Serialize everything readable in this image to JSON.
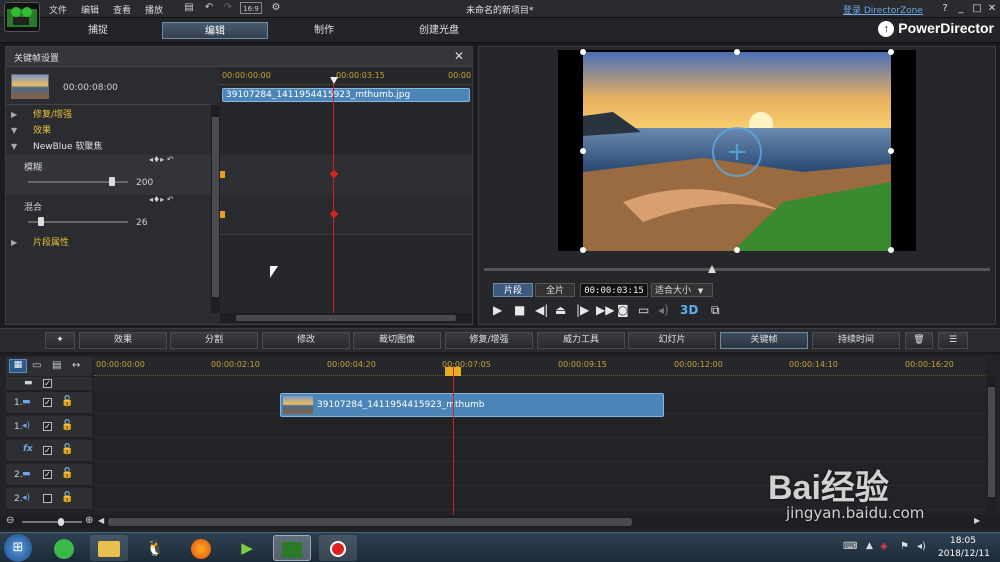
{
  "window": {
    "title": "未命名的新项目*",
    "zone_link": "登录 DirectorZone",
    "help": "?",
    "minimize": "_",
    "maximize": "□",
    "close": "✕",
    "aspect": "16:9"
  },
  "menu": [
    "文件",
    "编辑",
    "查看",
    "播放"
  ],
  "modes": {
    "capture": "捕捉",
    "edit": "编辑",
    "produce": "制作",
    "disc": "创建光盘",
    "logo": "PowerDirector"
  },
  "keyframe": {
    "title": "关键帧设置",
    "duration": "00:00:08:00",
    "ruler": [
      "00:00:00:00",
      "00:00:03:15",
      "00:00"
    ],
    "clip_name": "39107284_1411954415923_mthumb.jpg",
    "sections": {
      "fix": "修复/增强",
      "effect": "效果",
      "effect_name": "NewBlue 软聚焦",
      "clip_props": "片段属性"
    },
    "params": [
      {
        "label": "模糊",
        "value": "200",
        "level": 0.84
      },
      {
        "label": "混合",
        "value": "26",
        "level": 0.13
      }
    ]
  },
  "preview": {
    "mode_clip": "片段",
    "mode_movie": "全片",
    "timecode": "00:00:03:15",
    "fit": "适合大小",
    "fit_arrow": "▼",
    "threed": "3D"
  },
  "toolbar": [
    "效果",
    "分割",
    "修改",
    "裁切图像",
    "修复/增强",
    "威力工具",
    "幻灯片",
    "关键帧",
    "持续时间"
  ],
  "timeline": {
    "ruler": [
      "00:00:00:00",
      "00:00:02:10",
      "00:00:04:20",
      "00:00:07:05",
      "00:00:09:15",
      "00:00:12:00",
      "00:00:14:10",
      "00:00:16:20"
    ],
    "clip_name": "39107284_1411954415923_mthumb",
    "tracks": [
      {
        "num": "",
        "kind": "master"
      },
      {
        "num": "1.",
        "kind": "video"
      },
      {
        "num": "1.",
        "kind": "audio"
      },
      {
        "num": "",
        "kind": "fx",
        "label": "fx"
      },
      {
        "num": "2.",
        "kind": "video"
      },
      {
        "num": "2.",
        "kind": "audio"
      }
    ]
  },
  "taskbar": {
    "time": "18:05",
    "date": "2018/12/11"
  },
  "watermark": {
    "text": "Bai经验",
    "url": "jingyan.baidu.com"
  },
  "colors": {
    "accent": "#6d8aa8",
    "playhead": "#d02020",
    "ruler_text": "#c8a23a",
    "clip": "#4c86b8"
  }
}
